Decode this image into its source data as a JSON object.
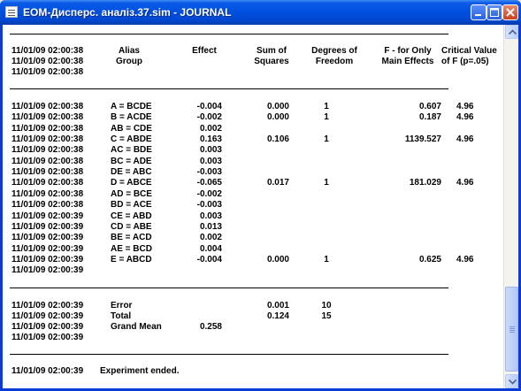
{
  "window": {
    "title": "EOM-Дисперс. аналіз.37.sim  -  JOURNAL"
  },
  "header": {
    "ts": "11/01/09 02:00:38",
    "alias_line1": "Alias",
    "alias_line2": "Group",
    "effect": "Effect",
    "ss_line1": "Sum of",
    "ss_line2": "Squares",
    "df_line1": "Degrees of",
    "df_line2": "Freedom",
    "f_line1": "F - for Only",
    "f_line2": "Main Effects",
    "cv_line1": "Critical Value",
    "cv_line2": "of F (p=.05)"
  },
  "rows": [
    {
      "ts": "11/01/09 02:00:38",
      "alias": "A =  BCDE",
      "effect": "-0.004",
      "ss": "0.000",
      "df": "1",
      "f": "0.607",
      "cv": "4.96"
    },
    {
      "ts": "11/01/09 02:00:38",
      "alias": "B =  ACDE",
      "effect": "-0.002",
      "ss": "0.000",
      "df": "1",
      "f": "0.187",
      "cv": "4.96"
    },
    {
      "ts": "11/01/09 02:00:38",
      "alias": "AB =  CDE",
      "effect": "0.002",
      "ss": "",
      "df": "",
      "f": "",
      "cv": ""
    },
    {
      "ts": "11/01/09 02:00:38",
      "alias": "C =  ABDE",
      "effect": "0.163",
      "ss": "0.106",
      "df": "1",
      "f": "1139.527",
      "cv": "4.96"
    },
    {
      "ts": "11/01/09 02:00:38",
      "alias": "AC =  BDE",
      "effect": "0.003",
      "ss": "",
      "df": "",
      "f": "",
      "cv": ""
    },
    {
      "ts": "11/01/09 02:00:38",
      "alias": "BC =  ADE",
      "effect": "0.003",
      "ss": "",
      "df": "",
      "f": "",
      "cv": ""
    },
    {
      "ts": "11/01/09 02:00:38",
      "alias": "DE =  ABC",
      "effect": "-0.003",
      "ss": "",
      "df": "",
      "f": "",
      "cv": ""
    },
    {
      "ts": "11/01/09 02:00:38",
      "alias": "D =  ABCE",
      "effect": "-0.065",
      "ss": "0.017",
      "df": "1",
      "f": "181.029",
      "cv": "4.96"
    },
    {
      "ts": "11/01/09 02:00:38",
      "alias": "AD =  BCE",
      "effect": "-0.002",
      "ss": "",
      "df": "",
      "f": "",
      "cv": ""
    },
    {
      "ts": "11/01/09 02:00:38",
      "alias": "BD =  ACE",
      "effect": "-0.003",
      "ss": "",
      "df": "",
      "f": "",
      "cv": ""
    },
    {
      "ts": "11/01/09 02:00:39",
      "alias": "CE =  ABD",
      "effect": "0.003",
      "ss": "",
      "df": "",
      "f": "",
      "cv": ""
    },
    {
      "ts": "11/01/09 02:00:39",
      "alias": "CD =  ABE",
      "effect": "0.013",
      "ss": "",
      "df": "",
      "f": "",
      "cv": ""
    },
    {
      "ts": "11/01/09 02:00:39",
      "alias": "BE =  ACD",
      "effect": "0.002",
      "ss": "",
      "df": "",
      "f": "",
      "cv": ""
    },
    {
      "ts": "11/01/09 02:00:39",
      "alias": "AE =  BCD",
      "effect": "0.004",
      "ss": "",
      "df": "",
      "f": "",
      "cv": ""
    },
    {
      "ts": "11/01/09 02:00:39",
      "alias": "E =  ABCD",
      "effect": "-0.004",
      "ss": "0.000",
      "df": "1",
      "f": "0.625",
      "cv": "4.96"
    },
    {
      "ts": "11/01/09 02:00:39",
      "alias": "",
      "effect": "",
      "ss": "",
      "df": "",
      "f": "",
      "cv": ""
    }
  ],
  "summary": {
    "error_ts": "11/01/09 02:00:39",
    "error_label": "Error",
    "error_ss": "0.001",
    "error_df": "10",
    "total_ts": "11/01/09 02:00:39",
    "total_label": "Total",
    "total_ss": "0.124",
    "total_df": "15",
    "mean_ts": "11/01/09 02:00:39",
    "mean_label": "Grand Mean",
    "mean_value": "0.258",
    "blank_ts": "11/01/09 02:00:39"
  },
  "footer": {
    "ts": "11/01/09 02:00:39",
    "message": "Experiment ended."
  }
}
